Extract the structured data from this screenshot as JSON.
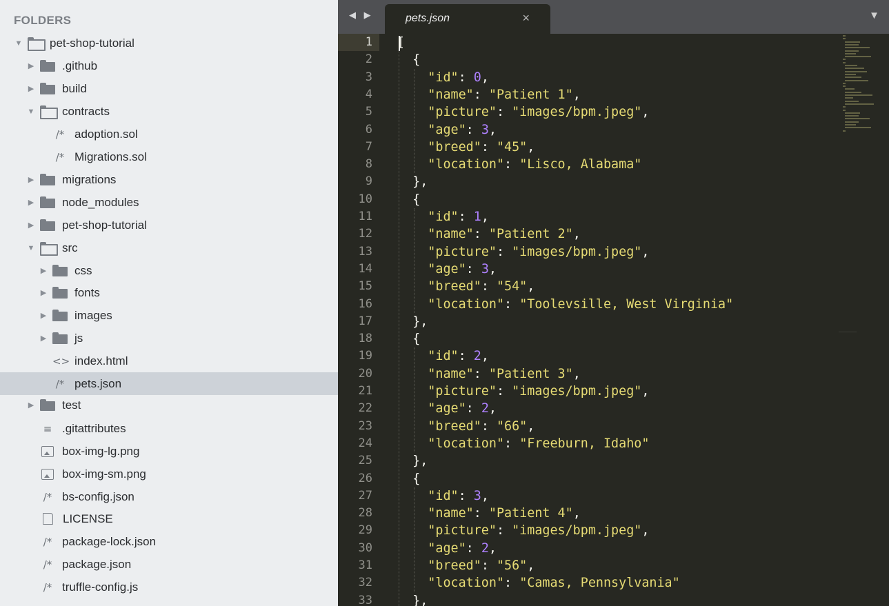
{
  "sidebar": {
    "header": "FOLDERS",
    "items": [
      {
        "label": "pet-shop-tutorial",
        "kind": "folder",
        "open": true,
        "depth": 0,
        "icon": "folder-open-icon"
      },
      {
        "label": ".github",
        "kind": "folder",
        "open": false,
        "depth": 1,
        "icon": "folder-icon"
      },
      {
        "label": "build",
        "kind": "folder",
        "open": false,
        "depth": 1,
        "icon": "folder-icon"
      },
      {
        "label": "contracts",
        "kind": "folder",
        "open": true,
        "depth": 1,
        "icon": "folder-open-icon"
      },
      {
        "label": "adoption.sol",
        "kind": "file",
        "glyph": "/*",
        "depth": 2,
        "icon": "code-file-icon"
      },
      {
        "label": "Migrations.sol",
        "kind": "file",
        "glyph": "/*",
        "depth": 2,
        "icon": "code-file-icon"
      },
      {
        "label": "migrations",
        "kind": "folder",
        "open": false,
        "depth": 1,
        "icon": "folder-icon"
      },
      {
        "label": "node_modules",
        "kind": "folder",
        "open": false,
        "depth": 1,
        "icon": "folder-icon"
      },
      {
        "label": "pet-shop-tutorial",
        "kind": "folder",
        "open": false,
        "depth": 1,
        "icon": "folder-icon"
      },
      {
        "label": "src",
        "kind": "folder",
        "open": true,
        "depth": 1,
        "icon": "folder-open-icon"
      },
      {
        "label": "css",
        "kind": "folder",
        "open": false,
        "depth": 2,
        "icon": "folder-icon"
      },
      {
        "label": "fonts",
        "kind": "folder",
        "open": false,
        "depth": 2,
        "icon": "folder-icon"
      },
      {
        "label": "images",
        "kind": "folder",
        "open": false,
        "depth": 2,
        "icon": "folder-icon"
      },
      {
        "label": "js",
        "kind": "folder",
        "open": false,
        "depth": 2,
        "icon": "folder-icon"
      },
      {
        "label": "index.html",
        "kind": "file",
        "glyph": "<>",
        "depth": 2,
        "icon": "html-file-icon"
      },
      {
        "label": "pets.json",
        "kind": "file",
        "glyph": "/*",
        "depth": 2,
        "icon": "code-file-icon",
        "selected": true
      },
      {
        "label": "test",
        "kind": "folder",
        "open": false,
        "depth": 1,
        "icon": "folder-icon"
      },
      {
        "label": ".gitattributes",
        "kind": "file",
        "glyph": "≡",
        "depth": 1,
        "icon": "text-file-icon"
      },
      {
        "label": "box-img-lg.png",
        "kind": "image",
        "depth": 1,
        "icon": "image-file-icon"
      },
      {
        "label": "box-img-sm.png",
        "kind": "image",
        "depth": 1,
        "icon": "image-file-icon"
      },
      {
        "label": "bs-config.json",
        "kind": "file",
        "glyph": "/*",
        "depth": 1,
        "icon": "code-file-icon"
      },
      {
        "label": "LICENSE",
        "kind": "doc",
        "depth": 1,
        "icon": "document-icon"
      },
      {
        "label": "package-lock.json",
        "kind": "file",
        "glyph": "/*",
        "depth": 1,
        "icon": "code-file-icon"
      },
      {
        "label": "package.json",
        "kind": "file",
        "glyph": "/*",
        "depth": 1,
        "icon": "code-file-icon"
      },
      {
        "label": "truffle-config.js",
        "kind": "file",
        "glyph": "/*",
        "depth": 1,
        "icon": "code-file-icon"
      }
    ]
  },
  "editor": {
    "tab_title": "pets.json",
    "tab_close": "×",
    "nav_arrows": "◀ ▶",
    "dropdown": "▼",
    "active_line": 1,
    "records": [
      {
        "id": "0",
        "name": "Patient 1",
        "picture": "images/bpm.jpeg",
        "age": "3",
        "breed": "45",
        "location": "Lisco, Alabama"
      },
      {
        "id": "1",
        "name": "Patient 2",
        "picture": "images/bpm.jpeg",
        "age": "3",
        "breed": "54",
        "location": "Toolevsille, West Virginia"
      },
      {
        "id": "2",
        "name": "Patient 3",
        "picture": "images/bpm.jpeg",
        "age": "2",
        "breed": "66",
        "location": "Freeburn, Idaho"
      },
      {
        "id": "3",
        "name": "Patient 4",
        "picture": "images/bpm.jpeg",
        "age": "2",
        "breed": "56",
        "location": "Camas, Pennsylvania"
      }
    ],
    "colors": {
      "background": "#272822",
      "string": "#e6db74",
      "number": "#ae81ff",
      "text": "#f8f8f2"
    }
  }
}
